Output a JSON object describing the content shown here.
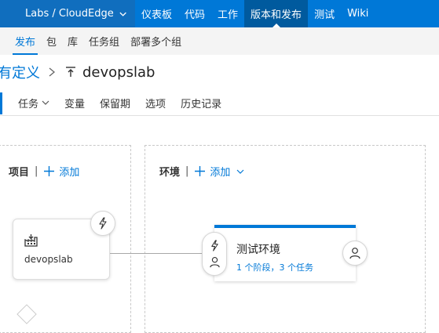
{
  "topbar": {
    "project": "Labs / CloudEdge",
    "nav": [
      "仪表板",
      "代码",
      "工作",
      "版本和发布",
      "测试",
      "Wiki"
    ],
    "active": 3
  },
  "subbar": {
    "items": [
      "发布",
      "包",
      "库",
      "任务组",
      "部署多个组"
    ],
    "active": 0
  },
  "breadcrumb": {
    "previous": "有定义",
    "title": "devopslab"
  },
  "tabs": {
    "items": [
      "任务",
      "变量",
      "保留期",
      "选项",
      "历史记录"
    ]
  },
  "pipeline": {
    "artifacts_heading": "项目",
    "artifacts_add": "添加",
    "environments_heading": "环境",
    "environments_add": "添加",
    "artifact": {
      "name": "devopslab",
      "icon": "build-icon"
    },
    "environment": {
      "name": "测试环境",
      "summary": "1 个阶段，3 个任务"
    }
  },
  "colors": {
    "accent": "#0078d7",
    "topbar": "#0078d7"
  }
}
